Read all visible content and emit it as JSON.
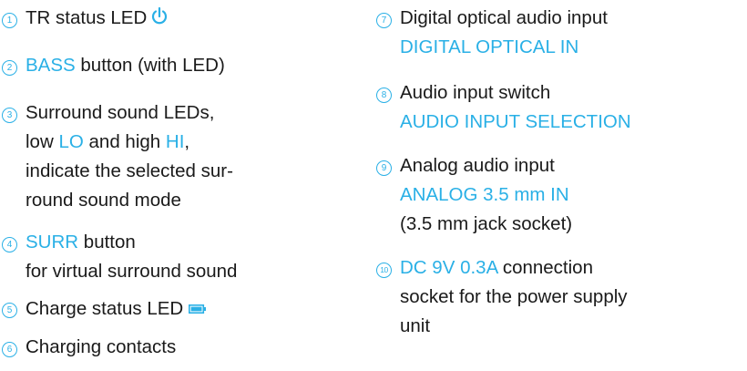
{
  "colors": {
    "accent": "#2ab0e6",
    "text": "#1a1a1a"
  },
  "left_items": [
    {
      "number": "1",
      "line1_text": "TR status LED",
      "icon": "power-icon"
    },
    {
      "number": "2",
      "line1_highlight": "BASS",
      "line1_text": " button (with LED)"
    },
    {
      "number": "3",
      "line1_text": "Surround sound LEDs,",
      "line2_pre": "low ",
      "line2_hl1": "LO",
      "line2_mid": " and high ",
      "line2_hl2": "HI",
      "line2_post": ",",
      "line3_text": "indicate the selected sur-",
      "line4_text": "round sound mode"
    },
    {
      "number": "4",
      "line1_highlight": "SURR",
      "line1_text": " button",
      "line2_text": "for virtual surround sound"
    },
    {
      "number": "5",
      "line1_text": "Charge status LED",
      "icon": "battery-icon"
    },
    {
      "number": "6",
      "line1_text": "Charging contacts"
    }
  ],
  "right_items": [
    {
      "number": "7",
      "line1_text": "Digital optical audio input",
      "line2_highlight": "DIGITAL OPTICAL IN"
    },
    {
      "number": "8",
      "line1_text": "Audio input switch",
      "line2_highlight": "AUDIO INPUT SELECTION"
    },
    {
      "number": "9",
      "line1_text": "Analog audio input",
      "line2_highlight": "ANALOG 3.5 mm IN",
      "line3_text": "(3.5 mm jack socket)"
    },
    {
      "number": "10",
      "line1_highlight": "DC 9V 0.3A",
      "line1_text": " connection",
      "line2_text": "socket for the power supply",
      "line3_text": "unit"
    }
  ]
}
